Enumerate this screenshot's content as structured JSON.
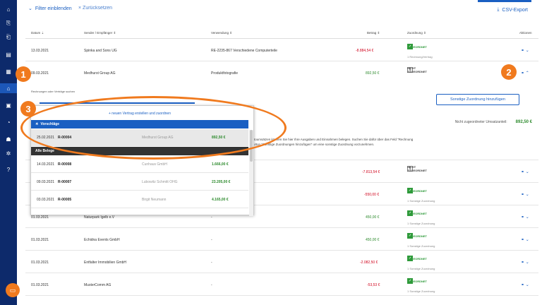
{
  "topbar": {
    "filter_label": "Filter einblenden",
    "reset_label": "Zurücksetzen",
    "csv_label": "CSV-Export"
  },
  "table": {
    "headers": {
      "date": "Datum ⇣",
      "party": "Sender / Empfänger ⇕",
      "purpose": "Verwendung ⇕",
      "amount": "Betrag ⇕",
      "assignment": "Zuordnung ⇕",
      "actions": "Aktionen"
    },
    "rows": [
      {
        "date": "13.03.2021",
        "party": "Spinka and Sons UG",
        "purpose": "RE-2235-867 Verschiedene Computerteile",
        "amount": "-8.884,54 €",
        "status": "ZUGEORDNET",
        "sub": "1 Rechnung/Vertrag"
      },
      {
        "date": "09.03.2021",
        "party": "Medhurst Group AG",
        "purpose": "Produktfotografie",
        "amount": "892,50 €",
        "status": "NICHT ZUGEORDNET",
        "sub": ""
      },
      {
        "date": "",
        "party": "",
        "purpose": "",
        "amount": "-7.813,54 €",
        "status": "NICHT ZUGEORDNET",
        "sub": ""
      },
      {
        "date": "",
        "party": "",
        "purpose": "",
        "amount": "-550,00 €",
        "status": "ZUGEORDNET",
        "sub": "1 Sonstige Zuordnung"
      },
      {
        "date": "01.03.2021",
        "party": "Naturpark Igelb e.V",
        "purpose": "-",
        "amount": "450,00 €",
        "status": "ZUGEORDNET",
        "sub": "1 Sonstige Zuordnung"
      },
      {
        "date": "01.03.2021",
        "party": "Echidna Events GmbH",
        "purpose": "-",
        "amount": "450,00 €",
        "status": "ZUGEORDNET",
        "sub": "1 Sonstige Zuordnung"
      },
      {
        "date": "01.03.2021",
        "party": "Entfalter Immobilien GmbH",
        "purpose": "-",
        "amount": "-2.082,50 €",
        "status": "ZUGEORDNET",
        "sub": "1 Sonstige Zuordnung"
      },
      {
        "date": "01.03.2021",
        "party": "MusterComm AG",
        "purpose": "-",
        "amount": "-53,53 €",
        "status": "ZUGEORDNET",
        "sub": "1 Sonstige Zuordnung"
      }
    ]
  },
  "panel": {
    "search_label": "Rechnungen oder Verträge suchen",
    "add_button": "Sonstige Zuordnung hinzufügen",
    "unassigned_label": "Nicht zugeordneter Umsatzanteil:",
    "unassigned_value": "892,50 €",
    "note_line1": "ertoumsätzen können Sie hier Ihre Ausgaben und Einnahmen belegen. Suchen Sie dafür über das Feld \"Rechnung",
    "note_line2": "Button \"Sonstige Zuordnungen hinzufügen\" um eine sonstige Zuordnung vorzunehmen."
  },
  "dropdown": {
    "new_link": "+ neuen Vertrag erstellen und zuordnen",
    "suggestions_label": "Vorschläge",
    "all_label": "Alle Belege",
    "suggestions": [
      {
        "date": "25.02.2021",
        "ref": "R-00004",
        "name": "Medhurst Group AG",
        "amount": "892,50 €"
      }
    ],
    "all": [
      {
        "date": "14.03.2021",
        "ref": "R-00008",
        "name": "Cunhaus GmbH",
        "amount": "1.666,00 €"
      },
      {
        "date": "09.03.2021",
        "ref": "R-00007",
        "name": "Lubowitz Schmitt OHG",
        "amount": "23.205,00 €"
      },
      {
        "date": "03.03.2021",
        "ref": "R-00005",
        "name": "Birgit Neumann",
        "amount": "4.165,00 €"
      }
    ]
  },
  "callouts": {
    "one": "1",
    "two": "2",
    "three": "3"
  },
  "colors": {
    "accent": "#1a5fc2",
    "nav": "#0d2a6b",
    "callout": "#f07a1e",
    "positive": "#2e8b2e",
    "negative": "#d0021b"
  },
  "icons": [
    "home-icon",
    "invoice-out-icon",
    "invoice-in-icon",
    "document-icon",
    "dashboard-icon",
    "bank-icon",
    "receipt-icon",
    "contacts-icon",
    "settings-icon",
    "help-icon",
    "chat-icon",
    "link-icon",
    "chevron-icon",
    "bulb-icon"
  ]
}
